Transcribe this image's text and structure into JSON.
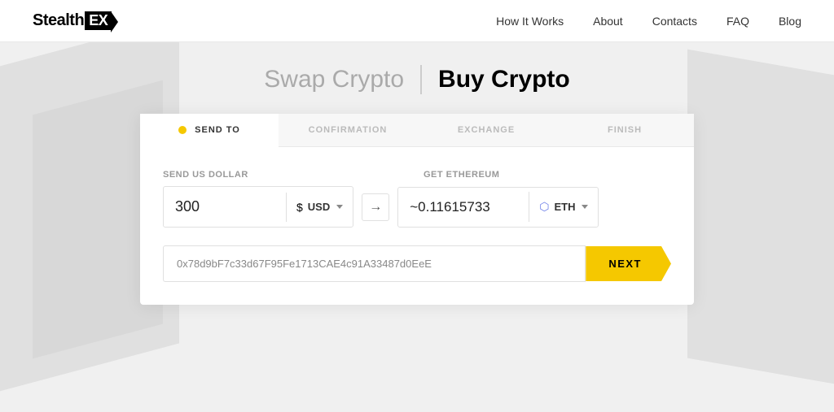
{
  "logo": {
    "text_stealth": "Stealth",
    "text_ex": "EX"
  },
  "nav": {
    "items": [
      {
        "label": "How It Works",
        "id": "how-it-works"
      },
      {
        "label": "About",
        "id": "about"
      },
      {
        "label": "Contacts",
        "id": "contacts"
      },
      {
        "label": "FAQ",
        "id": "faq"
      },
      {
        "label": "Blog",
        "id": "blog"
      }
    ]
  },
  "heading": {
    "swap_label": "Swap Crypto",
    "divider": "|",
    "buy_label": "Buy Crypto"
  },
  "steps": [
    {
      "label": "SEND TO",
      "active": true,
      "dot": true
    },
    {
      "label": "CONFIRMATION",
      "active": false,
      "dot": false
    },
    {
      "label": "EXCHANGE",
      "active": false,
      "dot": false
    },
    {
      "label": "FINISH",
      "active": false,
      "dot": false
    }
  ],
  "exchange": {
    "send_label": "SEND US DOLLAR",
    "get_label": "GET ETHEREUM",
    "send_amount": "300",
    "send_currency_icon": "$",
    "send_currency": "USD",
    "arrow": "→",
    "get_amount": "~0.11615733",
    "get_currency_icon": "⬡",
    "get_currency": "ETH"
  },
  "address": {
    "placeholder": "0x78d9bF7c33d67F95Fe1713CAE4c91A33487d0EeE",
    "value": "0x78d9bF7c33d67F95Fe1713CAE4c91A33487d0EeE"
  },
  "next_button": {
    "label": "NEXT"
  }
}
